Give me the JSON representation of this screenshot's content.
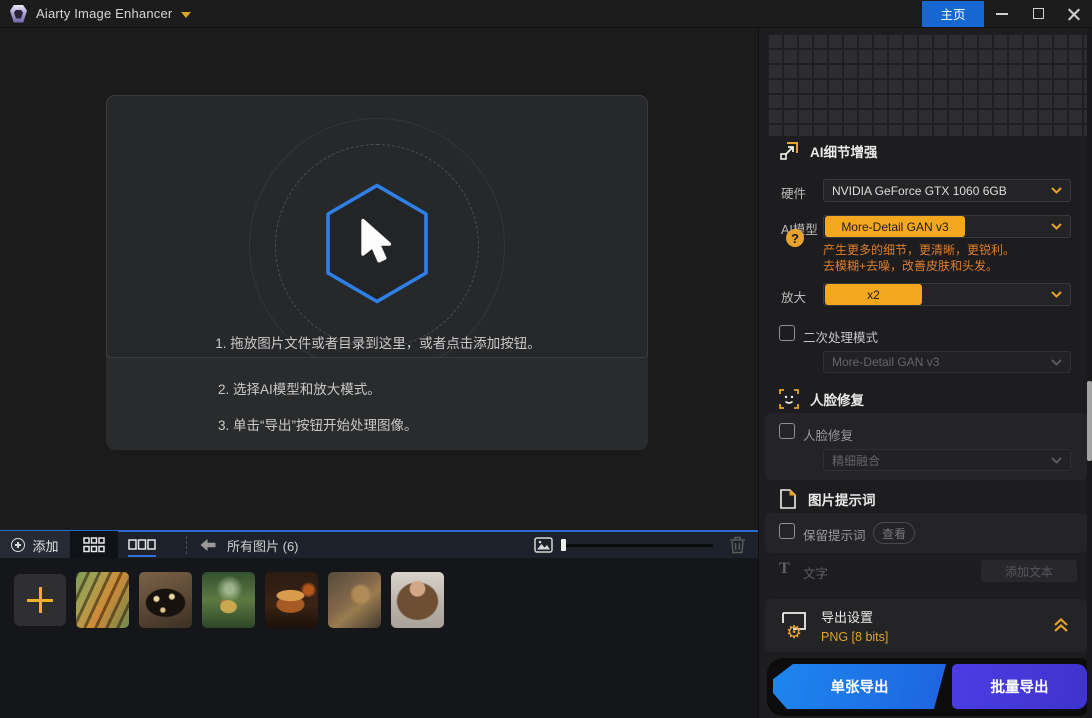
{
  "title_bar": {
    "app_title": "Aiarty Image Enhancer",
    "home_button": "主页"
  },
  "dropzone": {
    "instructions": [
      "1. 拖放图片文件或者目录到这里，或者点击添加按钮。",
      "2. 选择AI模型和放大模式。",
      "3. 单击“导出”按钮开始处理图像。"
    ]
  },
  "toolbar": {
    "add_label": "添加",
    "filter_label": "所有图片 (6)"
  },
  "thumbnails": [
    "tiger",
    "butterfly",
    "terrarium",
    "burger",
    "steampunk-dog",
    "girl-portrait"
  ],
  "right_panel": {
    "enhance_section": {
      "title": "AI细节增强",
      "hardware_label": "硬件",
      "hardware_value": "NVIDIA GeForce GTX 1060 6GB",
      "model_label": "AI模型",
      "model_value": "More-Detail GAN  v3",
      "help_glyph": "?",
      "model_desc_line1": "产生更多的细节，更清晰，更锐利。",
      "model_desc_line2": "去模糊+去噪，改善皮肤和头发。",
      "scale_label": "放大",
      "scale_value": "x2",
      "secondary_checkbox_label": "二次处理模式",
      "secondary_model_value": "More-Detail GAN  v3"
    },
    "face_section": {
      "title": "人脸修复",
      "checkbox_label": "人脸修复",
      "mode_value": "精细融合"
    },
    "prompt_section": {
      "title": "图片提示词",
      "keep_checkbox_label": "保留提示词",
      "view_button": "查看",
      "text_icon_glyph": "T",
      "text_label": "文字",
      "add_text_button": "添加文本"
    },
    "export_section": {
      "title": "导出设置",
      "format_line": "PNG   [8 bits]"
    },
    "export_buttons": {
      "single": "单张导出",
      "batch": "批量导出"
    }
  },
  "colors": {
    "accent_yellow": "#f2a71f",
    "accent_orange_text": "#dd7e2b",
    "accent_blue": "#1767d2",
    "toolbar_line_blue": "#2a6bd2",
    "export_single_gradient": [
      "#1d86ee",
      "#1e64e0"
    ],
    "export_batch_gradient": [
      "#4b3de2",
      "#3f33cd"
    ],
    "hexagon_stroke": "#2e80e8"
  }
}
